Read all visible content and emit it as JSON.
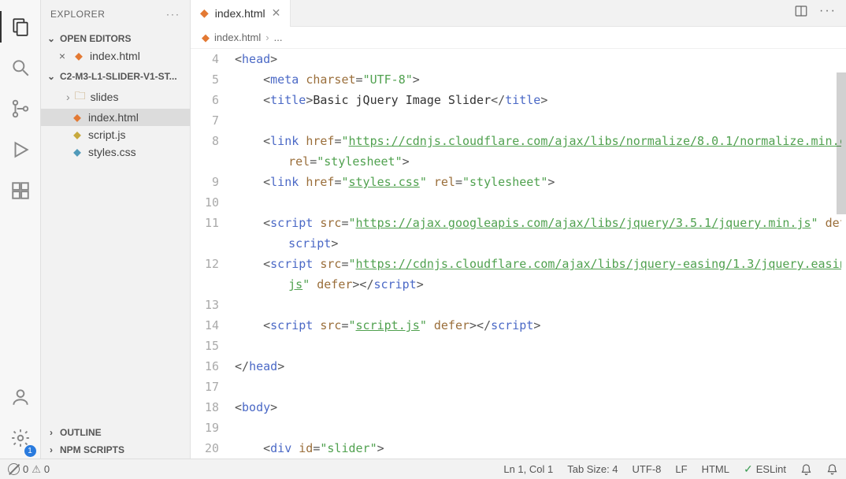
{
  "sidebar": {
    "title": "EXPLORER",
    "openEditors": {
      "label": "OPEN EDITORS",
      "items": [
        {
          "name": "index.html",
          "iconClass": "orange"
        }
      ]
    },
    "folder": {
      "label": "C2-M3-L1-SLIDER-V1-ST...",
      "items": [
        {
          "name": "slides",
          "type": "folder"
        },
        {
          "name": "index.html",
          "type": "file",
          "iconClass": "orange",
          "selected": true
        },
        {
          "name": "script.js",
          "type": "file",
          "iconClass": "yellow"
        },
        {
          "name": "styles.css",
          "type": "file",
          "iconClass": "blue"
        }
      ]
    },
    "outline": "OUTLINE",
    "npmScripts": "NPM SCRIPTS"
  },
  "extensionsBadge": "1",
  "tab": {
    "label": "index.html"
  },
  "breadcrumb": {
    "file": "index.html",
    "symbol": "..."
  },
  "code": {
    "startLine": 4,
    "lines": [
      {
        "n": 4,
        "html": "<span class='tok-punc'>&lt;</span><span class='tok-tag'>head</span><span class='tok-punc'>&gt;</span>"
      },
      {
        "n": 5,
        "indent": 1,
        "html": "<span class='tok-punc'>&lt;</span><span class='tok-tag'>meta</span> <span class='tok-attr'>charset</span><span class='tok-punc'>=</span><span class='tok-str'>\"UTF-8\"</span><span class='tok-punc'>&gt;</span>"
      },
      {
        "n": 6,
        "indent": 1,
        "html": "<span class='tok-punc'>&lt;</span><span class='tok-tag'>title</span><span class='tok-punc'>&gt;</span>Basic jQuery Image Slider<span class='tok-punc'>&lt;/</span><span class='tok-tag'>title</span><span class='tok-punc'>&gt;</span>"
      },
      {
        "n": 7,
        "indent": 1,
        "html": ""
      },
      {
        "n": 8,
        "indent": 1,
        "html": "<span class='tok-punc'>&lt;</span><span class='tok-tag'>link</span> <span class='tok-attr'>href</span><span class='tok-punc'>=</span><span class='tok-str'>\"<span class='underline'>https://cdnjs.cloudflare.com/ajax/libs/normalize/8.0.1/normalize.min.css</span>\"</span>"
      },
      {
        "wrap": true,
        "indent": 1,
        "html": "<span class='tok-attr'>rel</span><span class='tok-punc'>=</span><span class='tok-str'>\"stylesheet\"</span><span class='tok-punc'>&gt;</span>"
      },
      {
        "n": 9,
        "indent": 1,
        "html": "<span class='tok-punc'>&lt;</span><span class='tok-tag'>link</span> <span class='tok-attr'>href</span><span class='tok-punc'>=</span><span class='tok-str'>\"<span class='underline'>styles.css</span>\"</span> <span class='tok-attr'>rel</span><span class='tok-punc'>=</span><span class='tok-str'>\"stylesheet\"</span><span class='tok-punc'>&gt;</span>"
      },
      {
        "n": 10,
        "indent": 1,
        "html": ""
      },
      {
        "n": 11,
        "indent": 1,
        "html": "<span class='tok-punc'>&lt;</span><span class='tok-tag'>script</span> <span class='tok-attr'>src</span><span class='tok-punc'>=</span><span class='tok-str'>\"<span class='underline'>https://ajax.googleapis.com/ajax/libs/jquery/3.5.1/jquery.min.js</span>\"</span> <span class='tok-attr'>defer</span><span class='tok-punc'>&gt;&lt;/</span>"
      },
      {
        "wrap": true,
        "indent": 1,
        "html": "<span class='tok-tag'>script</span><span class='tok-punc'>&gt;</span>"
      },
      {
        "n": 12,
        "indent": 1,
        "html": "<span class='tok-punc'>&lt;</span><span class='tok-tag'>script</span> <span class='tok-attr'>src</span><span class='tok-punc'>=</span><span class='tok-str'>\"<span class='underline'>https://cdnjs.cloudflare.com/ajax/libs/jquery-easing/1.3/jquery.easing.min.</span></span>"
      },
      {
        "wrap": true,
        "indent": 1,
        "html": "<span class='tok-str'><span class='underline'>js</span>\"</span> <span class='tok-attr'>defer</span><span class='tok-punc'>&gt;&lt;/</span><span class='tok-tag'>script</span><span class='tok-punc'>&gt;</span>"
      },
      {
        "n": 13,
        "indent": 1,
        "html": ""
      },
      {
        "n": 14,
        "indent": 1,
        "html": "<span class='tok-punc'>&lt;</span><span class='tok-tag'>script</span> <span class='tok-attr'>src</span><span class='tok-punc'>=</span><span class='tok-str'>\"<span class='underline'>script.js</span>\"</span> <span class='tok-attr'>defer</span><span class='tok-punc'>&gt;&lt;/</span><span class='tok-tag'>script</span><span class='tok-punc'>&gt;</span>"
      },
      {
        "n": 15,
        "indent": 1,
        "html": ""
      },
      {
        "n": 16,
        "html": "<span class='tok-punc'>&lt;/</span><span class='tok-tag'>head</span><span class='tok-punc'>&gt;</span>"
      },
      {
        "n": 17,
        "html": ""
      },
      {
        "n": 18,
        "html": "<span class='tok-punc'>&lt;</span><span class='tok-tag'>body</span><span class='tok-punc'>&gt;</span>"
      },
      {
        "n": 19,
        "indent": 1,
        "html": ""
      },
      {
        "n": 20,
        "indent": 1,
        "cut": true,
        "html": "<span class='tok-punc'>&lt;</span><span class='tok-tag'>div</span> <span class='tok-attr'>id</span><span class='tok-punc'>=</span><span class='tok-str'>\"slider\"</span><span class='tok-punc'>&gt;</span>"
      }
    ]
  },
  "status": {
    "errors": "0",
    "warnings": "0",
    "cursor": "Ln 1, Col 1",
    "tabSize": "Tab Size: 4",
    "encoding": "UTF-8",
    "eol": "LF",
    "language": "HTML",
    "eslint": "ESLint"
  }
}
